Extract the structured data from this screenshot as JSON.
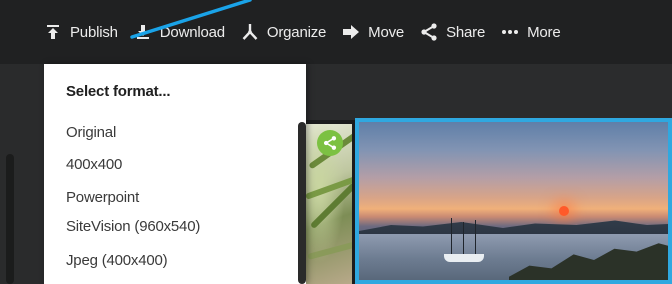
{
  "toolbar": {
    "items": [
      {
        "label": "Publish",
        "icon": "upload-icon"
      },
      {
        "label": "Download",
        "icon": "download-icon"
      },
      {
        "label": "Organize",
        "icon": "organize-icon"
      },
      {
        "label": "Move",
        "icon": "arrow-right-icon"
      },
      {
        "label": "Share",
        "icon": "share-icon"
      },
      {
        "label": "More",
        "icon": "more-dots-icon"
      }
    ]
  },
  "dropdown": {
    "header": "Select format...",
    "options": [
      "Original",
      "400x400",
      "Powerpoint",
      "SiteVision (960x540)",
      "Jpeg (400x400)"
    ]
  },
  "colors": {
    "toolbar_bg": "#202122",
    "selection_border": "#2fa8e0",
    "share_badge": "#7cc142",
    "annotation_arrow": "#1aa3e8"
  }
}
